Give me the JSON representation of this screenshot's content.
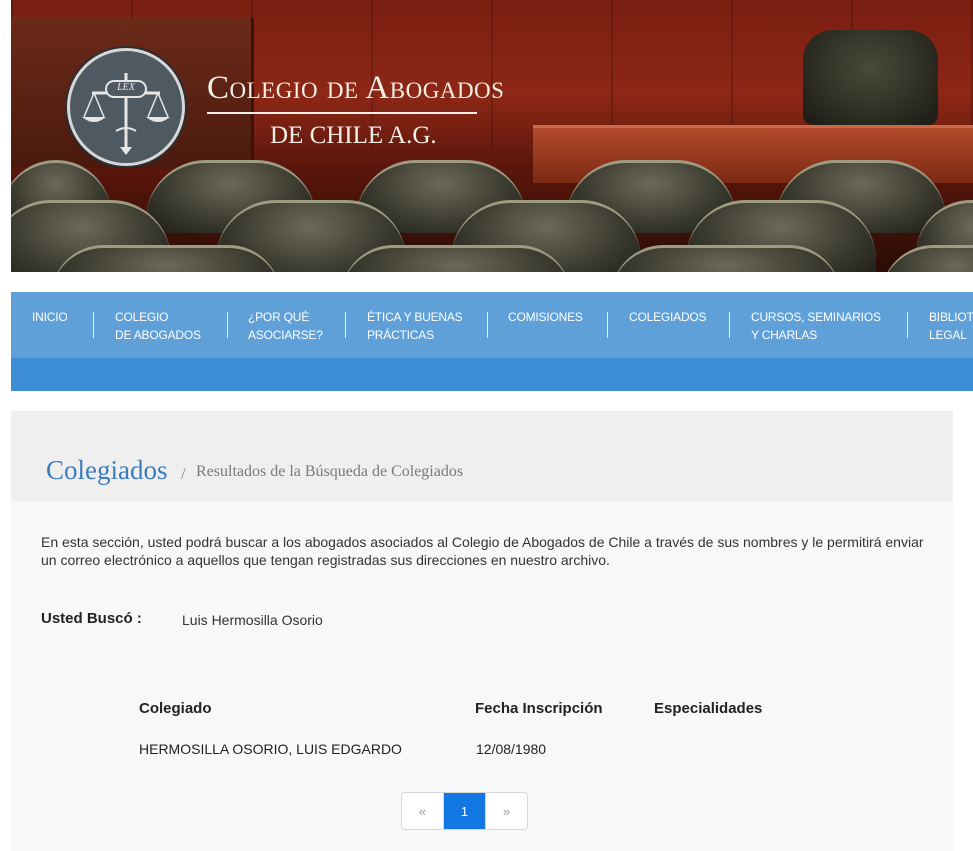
{
  "header": {
    "title": "Colegio de Abogados",
    "subtitle": "DE CHILE A.G.",
    "emblem_text": "LEX"
  },
  "nav": {
    "items": [
      {
        "label": "INICIO"
      },
      {
        "label": "COLEGIO\nDE ABOGADOS"
      },
      {
        "label": "¿POR QUÉ\nASOCIARSE?"
      },
      {
        "label": "ÉTICA Y BUENAS\nPRÁCTICAS"
      },
      {
        "label": "COMISIONES"
      },
      {
        "label": "COLEGIADOS"
      },
      {
        "label": "CURSOS, SEMINARIOS\nY CHARLAS"
      },
      {
        "label": "BIBLIOT\nLEGAL"
      }
    ]
  },
  "page": {
    "title": "Colegiados",
    "breadcrumb_sep": "/",
    "breadcrumb": "Resultados de la Búsqueda de Colegiados",
    "intro": "En esta sección, usted podrá buscar a los abogados asociados al Colegio de Abogados de Chile a través de sus nombres y le permitirá enviar un correo electrónico a aquellos que tengan registradas sus direcciones en nuestro archivo.",
    "search_label": "Usted Buscó :",
    "search_value": "Luis Hermosilla Osorio"
  },
  "table": {
    "headers": [
      "Colegiado",
      "Fecha Inscripción",
      "Especialidades"
    ],
    "rows": [
      [
        "HERMOSILLA OSORIO, LUIS EDGARDO",
        "12/08/1980",
        ""
      ]
    ]
  },
  "pagination": {
    "prev": "«",
    "current": "1",
    "next": "»"
  },
  "colors": {
    "nav_bg": "#5fa0d9",
    "subnav_bg": "#3d8cd6",
    "title_color": "#3a7cc0",
    "active_page": "#1277e3"
  }
}
